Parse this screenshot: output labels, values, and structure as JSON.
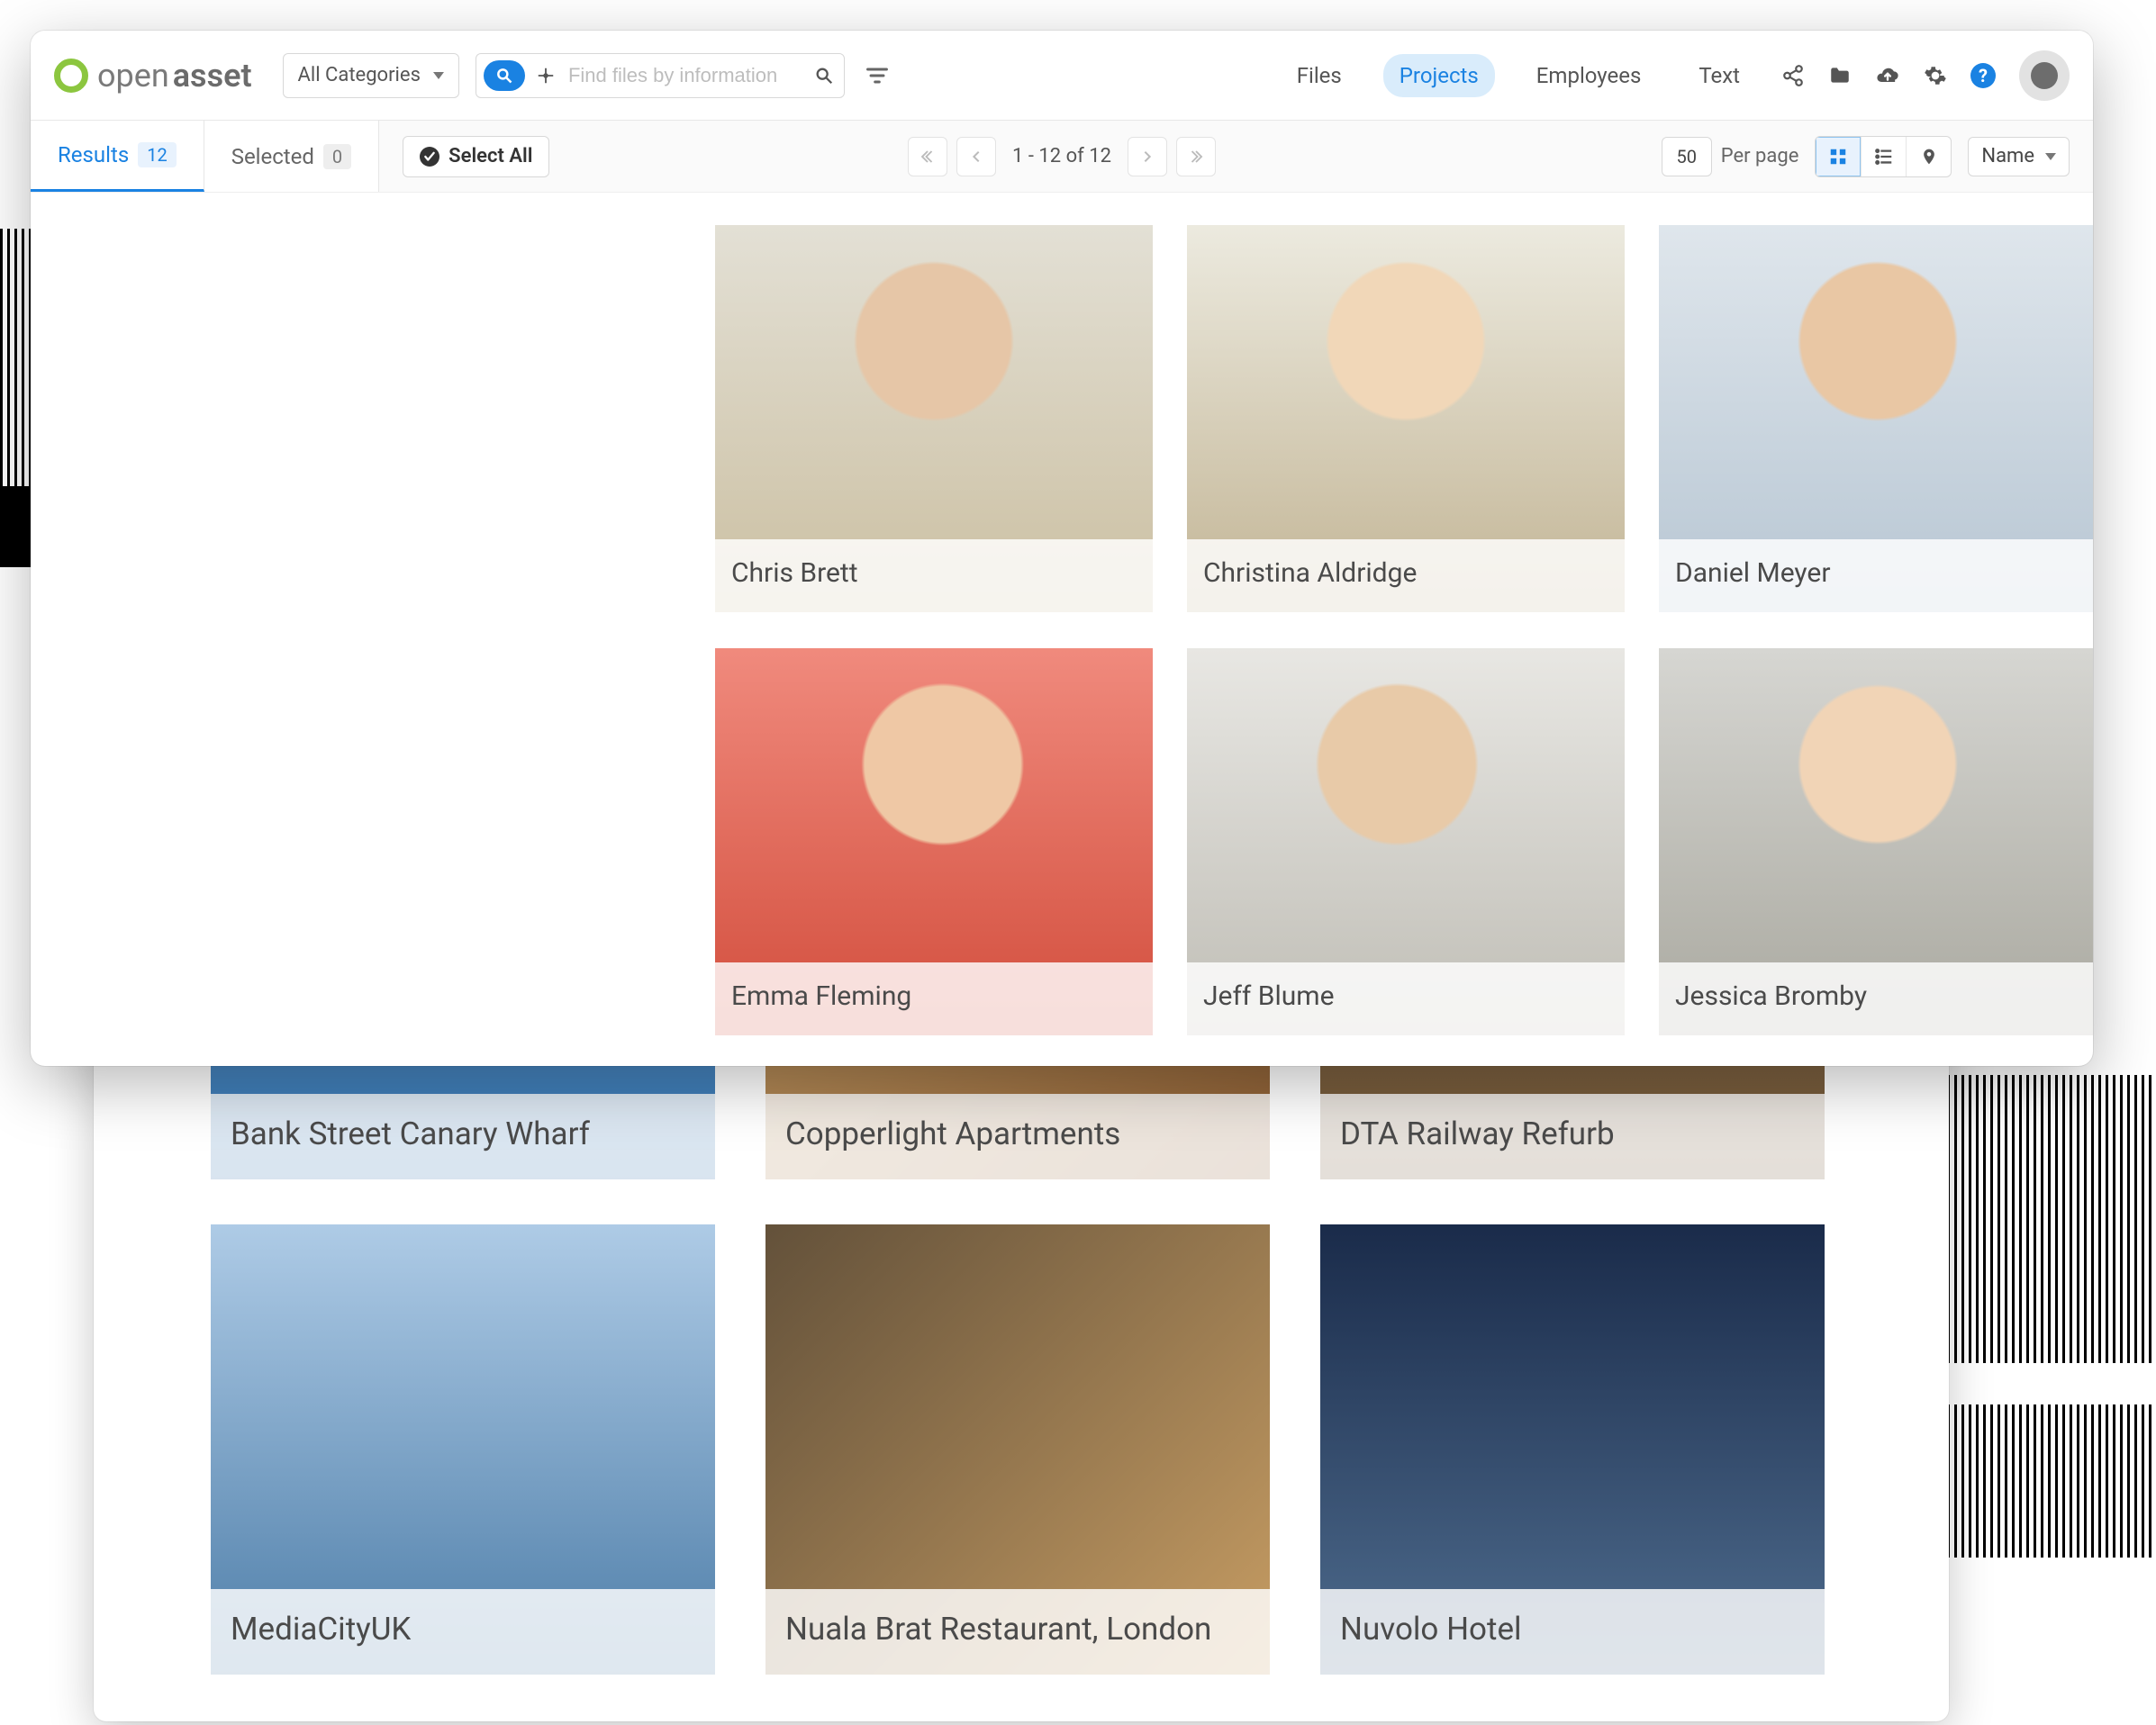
{
  "logo": {
    "part1": "open",
    "part2": "asset"
  },
  "categorySelector": "All Categories",
  "search": {
    "placeholder": "Find files by information"
  },
  "nav": {
    "files": "Files",
    "projects": "Projects",
    "employees": "Employees",
    "text": "Text"
  },
  "tabs": {
    "results": {
      "label": "Results",
      "count": "12"
    },
    "selected": {
      "label": "Selected",
      "count": "0"
    }
  },
  "selectAll": "Select All",
  "pager": {
    "range": "1 - 12 of 12"
  },
  "perPage": {
    "value": "50",
    "label": "Per page"
  },
  "sort": {
    "value": "Name"
  },
  "employees": [
    {
      "name": "Chris Brett"
    },
    {
      "name": "Christina Aldridge"
    },
    {
      "name": "Daniel Meyer"
    },
    {
      "name": "Emma Fleming"
    },
    {
      "name": "Jeff Blume"
    },
    {
      "name": "Jessica Bromby"
    }
  ],
  "projects": [
    {
      "name": "Bank Street Canary Wharf"
    },
    {
      "name": "Copperlight Apartments"
    },
    {
      "name": "DTA Railway Refurb"
    },
    {
      "name": "MediaCityUK"
    },
    {
      "name": "Nuala Brat Restaurant, London"
    },
    {
      "name": "Nuvolo Hotel"
    }
  ]
}
